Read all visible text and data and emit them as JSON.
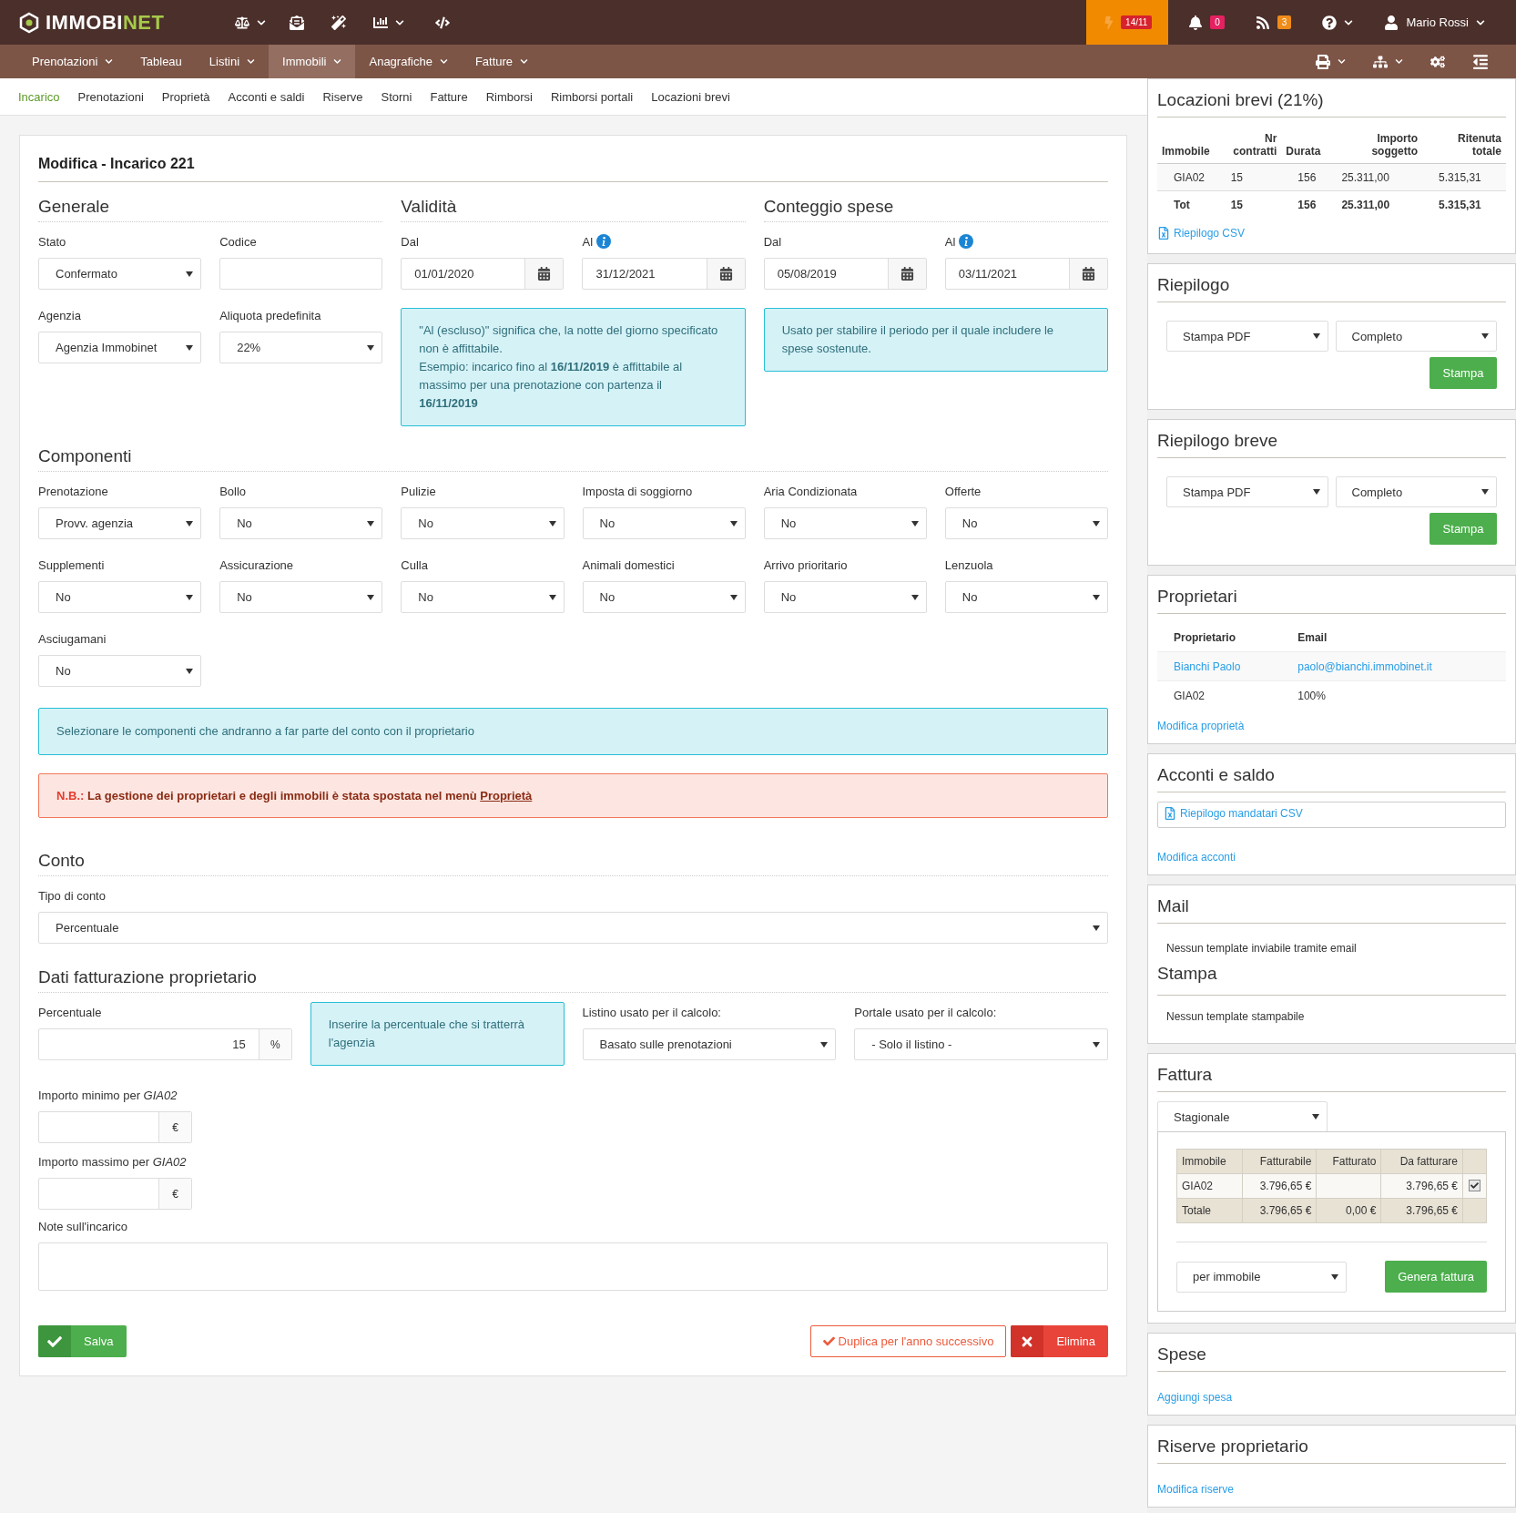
{
  "topbar": {
    "logo_parts": [
      "IMMOBI",
      "NET"
    ],
    "alert_badge": "14/11",
    "notification_count": "0",
    "feed_count": "3",
    "user": "Mario Rossi"
  },
  "menu": [
    {
      "label": "Prenotazioni",
      "selected": false,
      "dropdown": true
    },
    {
      "label": "Tableau",
      "selected": false,
      "dropdown": false
    },
    {
      "label": "Listini",
      "selected": false,
      "dropdown": true
    },
    {
      "label": "Immobili",
      "selected": true,
      "dropdown": true
    },
    {
      "label": "Anagrafiche",
      "selected": false,
      "dropdown": true
    },
    {
      "label": "Fatture",
      "selected": false,
      "dropdown": true
    }
  ],
  "subnav": [
    {
      "label": "Incarico",
      "selected": true
    },
    {
      "label": "Prenotazioni",
      "selected": false
    },
    {
      "label": "Proprietà",
      "selected": false
    },
    {
      "label": "Acconti e saldi",
      "selected": false
    },
    {
      "label": "Riserve",
      "selected": false
    },
    {
      "label": "Storni",
      "selected": false
    },
    {
      "label": "Fatture",
      "selected": false
    },
    {
      "label": "Rimborsi",
      "selected": false
    },
    {
      "label": "Rimborsi portali",
      "selected": false
    },
    {
      "label": "Locazioni brevi",
      "selected": false
    }
  ],
  "form": {
    "title": "Modifica - Incarico 221",
    "generale": {
      "title": "Generale",
      "fields": [
        {
          "label": "Stato",
          "kind": "select",
          "value": "Confermato"
        },
        {
          "label": "Codice",
          "kind": "text"
        },
        {
          "label": "Agenzia",
          "kind": "select",
          "value": "Agenzia Immobinet"
        },
        {
          "label": "Aliquota predefinita",
          "kind": "select",
          "value": "22%"
        }
      ]
    },
    "validita": {
      "title": "Validità",
      "fields": [
        {
          "label": "Dal",
          "kind": "date",
          "value": "01/01/2020"
        },
        {
          "label": "Al",
          "kind": "date",
          "value": "31/12/2021",
          "info": true
        }
      ],
      "note": [
        "\"Al (escluso)\" significa che, la notte del giorno specificato non è affittabile.",
        "Esempio: incarico fino al **16/11/2019** è affittabile al massimo per una prenotazione con partenza il **16/11/2019**"
      ]
    },
    "conteggio": {
      "title": "Conteggio spese",
      "fields": [
        {
          "label": "Dal",
          "kind": "date",
          "value": "05/08/2019"
        },
        {
          "label": "Al",
          "kind": "date",
          "value": "03/11/2021",
          "info": true
        }
      ],
      "note": [
        "Usato per stabilire il periodo per il quale includere le spese sostenute."
      ]
    },
    "componenti": {
      "title": "Componenti",
      "fields": [
        {
          "label": "Prenotazione",
          "kind": "select",
          "value": "Provv. agenzia"
        },
        {
          "label": "Bollo",
          "kind": "select",
          "value": "No"
        },
        {
          "label": "Pulizie",
          "kind": "select",
          "value": "No"
        },
        {
          "label": "Imposta di soggiorno",
          "kind": "select",
          "value": "No"
        },
        {
          "label": "Aria Condizionata",
          "kind": "select",
          "value": "No"
        },
        {
          "label": "Offerte",
          "kind": "select",
          "value": "No"
        },
        {
          "label": "Supplementi",
          "kind": "select",
          "value": "No"
        },
        {
          "label": "Assicurazione",
          "kind": "select",
          "value": "No"
        },
        {
          "label": "Culla",
          "kind": "select",
          "value": "No"
        },
        {
          "label": "Animali domestici",
          "kind": "select",
          "value": "No"
        },
        {
          "label": "Arrivo prioritario",
          "kind": "select",
          "value": "No"
        },
        {
          "label": "Lenzuola",
          "kind": "select",
          "value": "No"
        },
        {
          "label": "Asciugamani",
          "kind": "select",
          "value": "No"
        }
      ],
      "note": "Selezionare le componenti che andranno a far parte del conto con il proprietario"
    },
    "notice": {
      "prefix": "N.B.:",
      "text": "La gestione dei proprietari e degli immobili è stata spostata nel menù",
      "link": "Proprietà"
    },
    "conto": {
      "title": "Conto",
      "field": {
        "label": "Tipo di conto",
        "kind": "select",
        "value": "Percentuale"
      }
    },
    "fatturazione": {
      "title": "Dati fatturazione proprietario",
      "percentuale": {
        "label": "Percentuale",
        "value": "15",
        "addon": "%"
      },
      "note": "Inserire la percentuale che si tratterrà l'agenzia",
      "listino": {
        "label": "Listino usato per il calcolo:",
        "kind": "select",
        "value": "Basato sulle prenotazioni"
      },
      "portale": {
        "label": "Portale usato per il calcolo:",
        "kind": "select",
        "value": "- Solo il listino -"
      },
      "amounts": [
        {
          "label": "Importo minimo per *GIA02*",
          "addon": "€"
        },
        {
          "label": "Importo massimo per *GIA02*",
          "addon": "€"
        }
      ],
      "notes_label": "Note sull'incarico"
    },
    "actions": {
      "save": "Salva",
      "duplicate": "Duplica per l'anno successivo",
      "delete": "Elimina"
    }
  },
  "sidebar": [
    {
      "kind": "summary_table",
      "title": "Locazioni brevi (21%)",
      "columns": [
        "Immobile",
        "Nr contratti",
        "Durata",
        "Importo soggetto",
        "Ritenuta totale"
      ],
      "rows": [
        [
          "GIA02",
          "15",
          "156",
          "25.311,00",
          "5.315,31"
        ]
      ],
      "total": [
        "Tot",
        "15",
        "156",
        "25.311,00",
        "5.315,31"
      ],
      "link": "Riepilogo CSV"
    },
    {
      "kind": "print",
      "title": "Riepilogo",
      "selects": [
        "Stampa PDF",
        "Completo"
      ],
      "button": "Stampa"
    },
    {
      "kind": "print",
      "title": "Riepilogo breve",
      "selects": [
        "Stampa PDF",
        "Completo"
      ],
      "button": "Stampa"
    },
    {
      "kind": "owners",
      "title": "Proprietari",
      "columns": [
        "Proprietario",
        "Email"
      ],
      "owner": [
        "Bianchi Paolo",
        "paolo@bianchi.immobinet.it"
      ],
      "share": [
        "GIA02",
        "100%"
      ],
      "link": "Modifica proprietà"
    },
    {
      "kind": "acconti",
      "title": "Acconti e saldo",
      "file_link": "Riepilogo mandatari CSV",
      "link": "Modifica acconti"
    },
    {
      "kind": "templates",
      "title": "Mail",
      "text": "Nessun template inviabile tramite email",
      "subtitle": "Stampa",
      "subtext": "Nessun template stampabile"
    },
    {
      "kind": "invoice",
      "title": "Fattura",
      "select": "Stagionale",
      "columns": [
        "Immobile",
        "Fatturabile",
        "Fatturato",
        "Da fatturare"
      ],
      "rows": [
        {
          "property": "GIA02",
          "billable": "3.796,65 €",
          "to_bill": "3.796,65 €",
          "checked": true
        }
      ],
      "total": {
        "label": "Totale",
        "billable": "3.796,65 €",
        "billed": "0,00 €",
        "to_bill": "3.796,65 €"
      },
      "group_by": "per immobile",
      "button": "Genera fattura"
    },
    {
      "kind": "links",
      "title": "Spese",
      "link": "Aggiungi spesa"
    },
    {
      "kind": "links",
      "title": "Riserve proprietario",
      "link": "Modifica riserve"
    }
  ]
}
